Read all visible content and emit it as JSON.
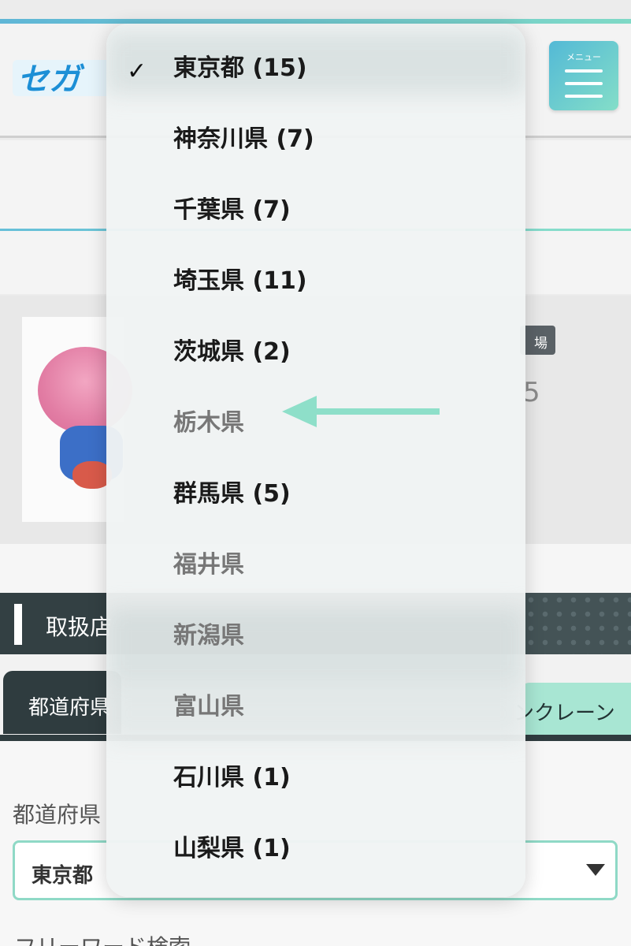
{
  "header": {
    "logo_text": "セガ",
    "menu_label": "メニュー"
  },
  "product": {
    "tag": "場",
    "price_glyph": "5"
  },
  "section": {
    "title": "取扱店"
  },
  "tabs": {
    "left_label": "都道府県",
    "right_label": "ンクレーン"
  },
  "form": {
    "prefecture_label": "都道府県",
    "selected_value": "東京都",
    "freeword_label": "フリーワード検索"
  },
  "dropdown": {
    "items": [
      {
        "label": "東京都 (15)",
        "selected": true,
        "enabled": true
      },
      {
        "label": "神奈川県 (7)",
        "selected": false,
        "enabled": true
      },
      {
        "label": "千葉県 (7)",
        "selected": false,
        "enabled": true
      },
      {
        "label": "埼玉県 (11)",
        "selected": false,
        "enabled": true
      },
      {
        "label": "茨城県 (2)",
        "selected": false,
        "enabled": true
      },
      {
        "label": "栃木県",
        "selected": false,
        "enabled": false
      },
      {
        "label": "群馬県 (5)",
        "selected": false,
        "enabled": true
      },
      {
        "label": "福井県",
        "selected": false,
        "enabled": false
      },
      {
        "label": "新潟県",
        "selected": false,
        "enabled": false
      },
      {
        "label": "富山県",
        "selected": false,
        "enabled": false
      },
      {
        "label": "石川県 (1)",
        "selected": false,
        "enabled": true
      },
      {
        "label": "山梨県 (1)",
        "selected": false,
        "enabled": true
      }
    ],
    "check_glyph": "✓"
  },
  "colors": {
    "accent": "#8edfc9",
    "dark": "#2f3c3f",
    "menu_gradient_start": "#53b9d6"
  },
  "icons": [
    "check-icon",
    "hamburger-menu-icon",
    "dropdown-caret-icon",
    "arrow-left-icon"
  ]
}
